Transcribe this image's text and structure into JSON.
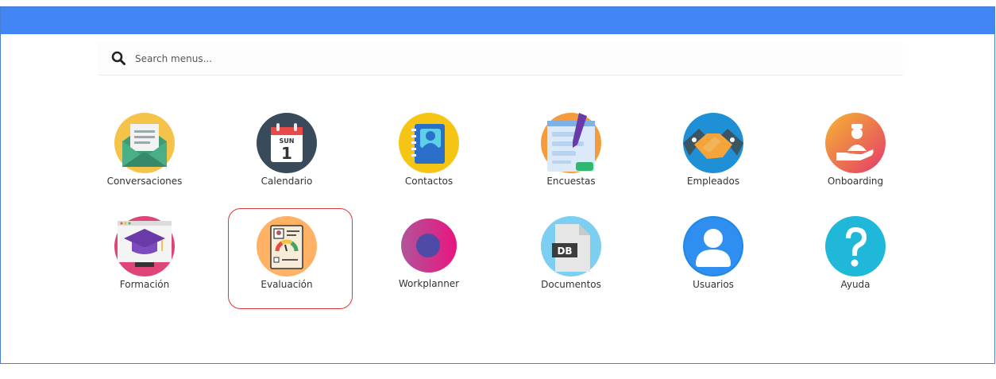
{
  "search": {
    "placeholder": "Search menus..."
  },
  "menus": {
    "conversaciones": "Conversaciones",
    "calendario": "Calendario",
    "calendario_day": "SUN",
    "calendario_num": "1",
    "contactos": "Contactos",
    "encuestas": "Encuestas",
    "empleados": "Empleados",
    "onboarding": "Onboarding",
    "formacion": "Formación",
    "evaluacion": "Evaluación",
    "workplanner": "Workplanner",
    "documentos": "Documentos",
    "documentos_badge": "DB",
    "usuarios": "Usuarios",
    "ayuda": "Ayuda"
  },
  "colors": {
    "topbar": "#4285f4",
    "highlight": "#d63a3a"
  },
  "selected": "Evaluación"
}
